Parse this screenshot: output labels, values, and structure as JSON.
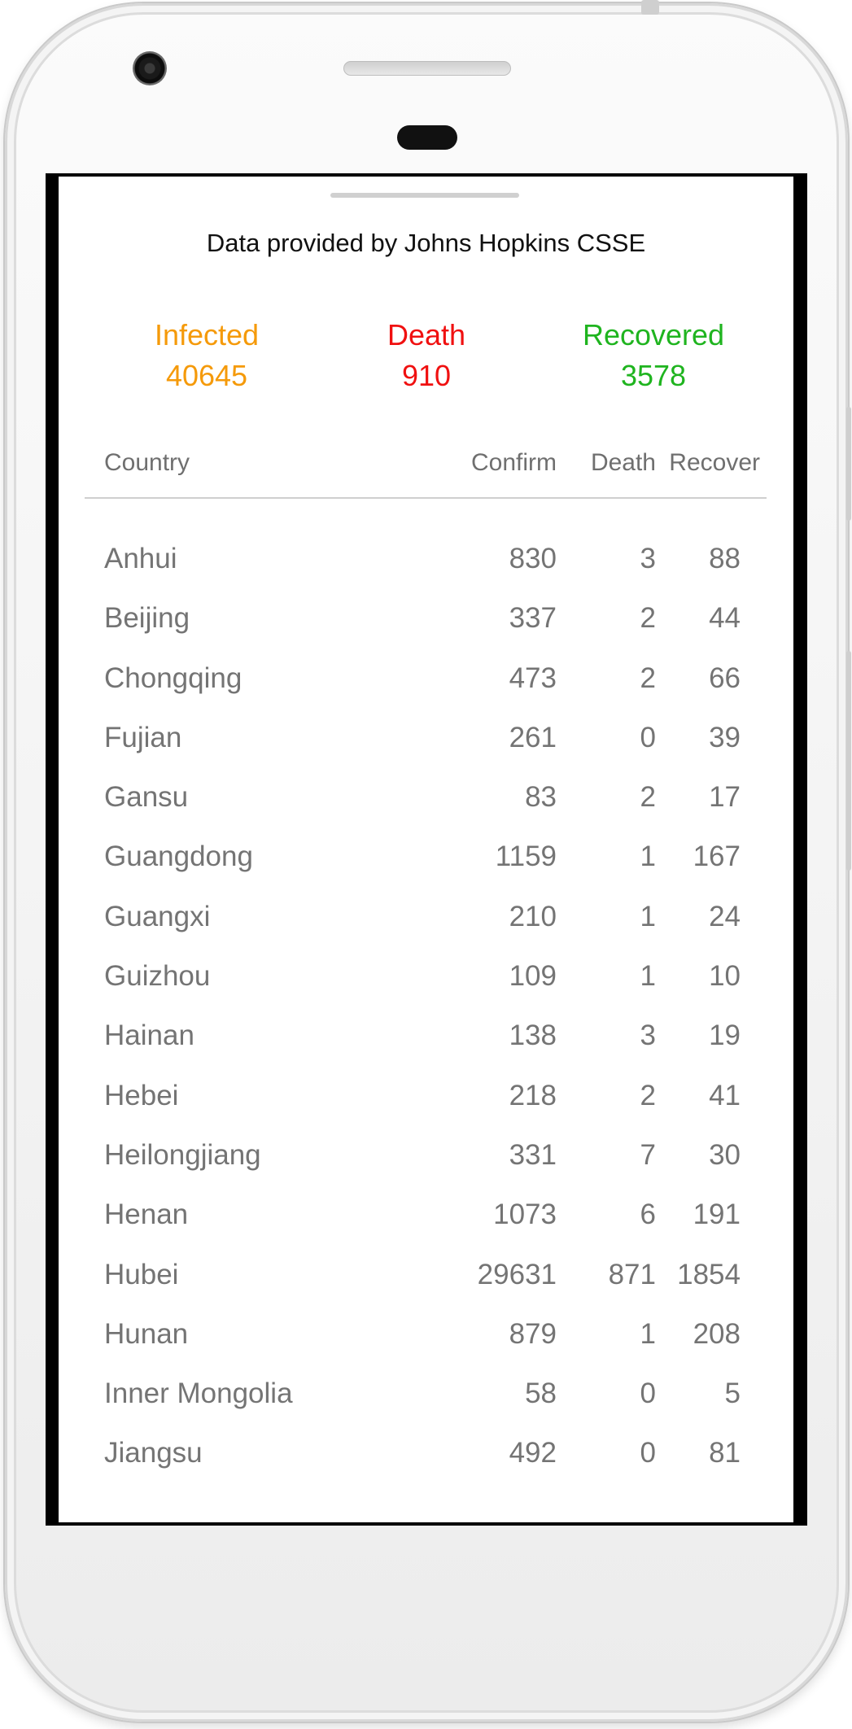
{
  "header": {
    "source_text": "Data provided by Johns Hopkins CSSE"
  },
  "stats": {
    "infected": {
      "label": "Infected",
      "value": "40645",
      "color": "#f59a0a"
    },
    "death": {
      "label": "Death",
      "value": "910",
      "color": "#f01010"
    },
    "recovered": {
      "label": "Recovered",
      "value": "3578",
      "color": "#1fb41f"
    }
  },
  "table": {
    "columns": [
      "Country",
      "Confirm",
      "Death",
      "Recover"
    ],
    "rows": [
      {
        "name": "Anhui",
        "confirm": "830",
        "death": "3",
        "recover": "88"
      },
      {
        "name": "Beijing",
        "confirm": "337",
        "death": "2",
        "recover": "44"
      },
      {
        "name": "Chongqing",
        "confirm": "473",
        "death": "2",
        "recover": "66"
      },
      {
        "name": "Fujian",
        "confirm": "261",
        "death": "0",
        "recover": "39"
      },
      {
        "name": "Gansu",
        "confirm": "83",
        "death": "2",
        "recover": "17"
      },
      {
        "name": "Guangdong",
        "confirm": "1159",
        "death": "1",
        "recover": "167"
      },
      {
        "name": "Guangxi",
        "confirm": "210",
        "death": "1",
        "recover": "24"
      },
      {
        "name": "Guizhou",
        "confirm": "109",
        "death": "1",
        "recover": "10"
      },
      {
        "name": "Hainan",
        "confirm": "138",
        "death": "3",
        "recover": "19"
      },
      {
        "name": "Hebei",
        "confirm": "218",
        "death": "2",
        "recover": "41"
      },
      {
        "name": "Heilongjiang",
        "confirm": "331",
        "death": "7",
        "recover": "30"
      },
      {
        "name": "Henan",
        "confirm": "1073",
        "death": "6",
        "recover": "191"
      },
      {
        "name": "Hubei",
        "confirm": "29631",
        "death": "871",
        "recover": "1854"
      },
      {
        "name": "Hunan",
        "confirm": "879",
        "death": "1",
        "recover": "208"
      },
      {
        "name": "Inner Mongolia",
        "confirm": "58",
        "death": "0",
        "recover": "5"
      },
      {
        "name": "Jiangsu",
        "confirm": "492",
        "death": "0",
        "recover": "81"
      }
    ]
  }
}
